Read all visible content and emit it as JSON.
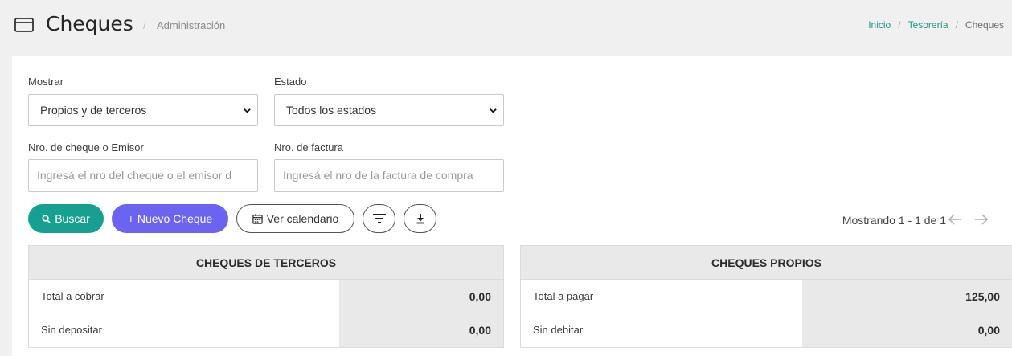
{
  "header": {
    "title": "Cheques",
    "separator": "/",
    "subtitle": "Administración",
    "icon": "credit-card-icon",
    "breadcrumb": [
      "Inicio",
      "Tesorería",
      "Cheques"
    ],
    "breadcrumb_separator": "/"
  },
  "filters": {
    "mostrar_label": "Mostrar",
    "mostrar_value": "Propios y de terceros",
    "estado_label": "Estado",
    "estado_value": "Todos los estados",
    "cheque_label": "Nro. de cheque o Emisor",
    "cheque_placeholder": "Ingresá el nro del cheque o el emisor d",
    "factura_label": "Nro. de factura",
    "factura_placeholder": "Ingresá el nro de la factura de compra"
  },
  "actions": {
    "search_label": "Buscar",
    "new_label": "+ Nuevo Cheque",
    "calendar_label": "Ver calendario"
  },
  "pagination": {
    "text": "Mostrando 1 - 1 de 1"
  },
  "terceros": {
    "title": "CHEQUES DE TERCEROS",
    "rows": [
      {
        "label": "Total a cobrar",
        "value": "0,00"
      },
      {
        "label": "Sin depositar",
        "value": "0,00"
      }
    ]
  },
  "propios": {
    "title": "CHEQUES PROPIOS",
    "rows": [
      {
        "label": "Total a pagar",
        "value": "125,00"
      },
      {
        "label": "Sin debitar",
        "value": "0,00"
      }
    ]
  },
  "colors": {
    "primary": "#17a090",
    "accent": "#6c63f0",
    "link": "#21968a"
  }
}
